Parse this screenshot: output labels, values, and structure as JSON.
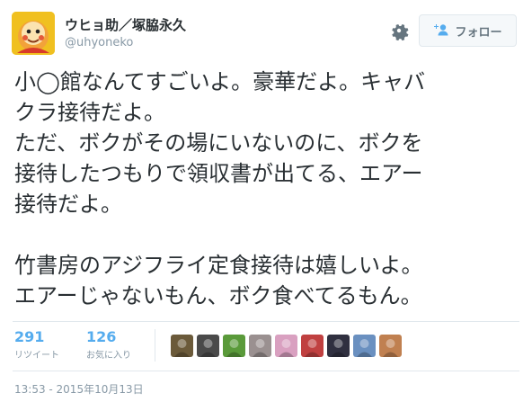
{
  "header": {
    "display_name": "ウヒョ助／塚脇永久",
    "username": "@uhyoneko",
    "follow_label": "フォロー"
  },
  "tweet": {
    "lines": [
      "小◯館なんてすごいよ。豪華だよ。キャバ",
      "クラ接待だよ。",
      "ただ、ボクがその場にいないのに、ボクを",
      "接待したつもりで領収書が出てる、エアー",
      "接待だよ。",
      "",
      "竹書房のアジフライ定食接待は嬉しいよ。",
      "エアーじゃないもん、ボク食べてるもん。"
    ]
  },
  "stats": {
    "retweets": {
      "count": "291",
      "label": "リツイート"
    },
    "favorites": {
      "count": "126",
      "label": "お気に入り"
    }
  },
  "favoriters": [
    {
      "icon": "avatar-dragon",
      "color": "#6b5a3a"
    },
    {
      "icon": "avatar-dark",
      "color": "#4a4a4a"
    },
    {
      "icon": "avatar-green-creature",
      "color": "#5a9a3a"
    },
    {
      "icon": "avatar-gray",
      "color": "#9a9090"
    },
    {
      "icon": "avatar-anime-girl-pink",
      "color": "#d9a0c0"
    },
    {
      "icon": "avatar-red-character",
      "color": "#c04040"
    },
    {
      "icon": "avatar-dark-haired",
      "color": "#303040"
    },
    {
      "icon": "avatar-blue-scene",
      "color": "#6a90c0"
    },
    {
      "icon": "avatar-orange-haired",
      "color": "#c08050"
    }
  ],
  "timestamp": "13:53 - 2015年10月13日",
  "colors": {
    "accent": "#55acee",
    "muted": "#8899a6",
    "text": "#292f33"
  }
}
